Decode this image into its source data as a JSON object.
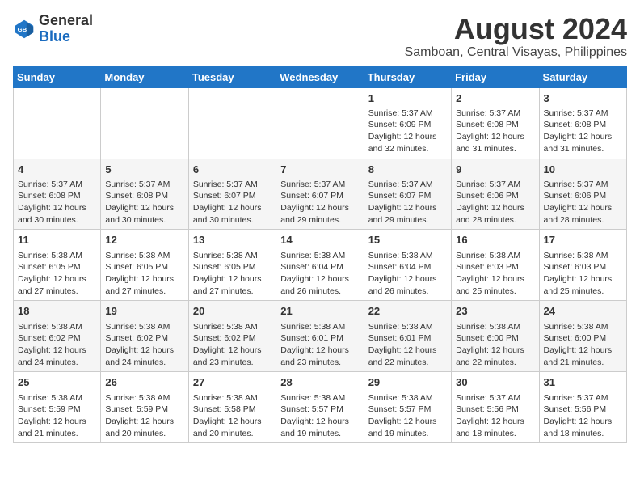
{
  "logo": {
    "general": "General",
    "blue": "Blue"
  },
  "title": "August 2024",
  "subtitle": "Samboan, Central Visayas, Philippines",
  "weekdays": [
    "Sunday",
    "Monday",
    "Tuesday",
    "Wednesday",
    "Thursday",
    "Friday",
    "Saturday"
  ],
  "weeks": [
    [
      {
        "day": "",
        "info": ""
      },
      {
        "day": "",
        "info": ""
      },
      {
        "day": "",
        "info": ""
      },
      {
        "day": "",
        "info": ""
      },
      {
        "day": "1",
        "info": "Sunrise: 5:37 AM\nSunset: 6:09 PM\nDaylight: 12 hours and 32 minutes."
      },
      {
        "day": "2",
        "info": "Sunrise: 5:37 AM\nSunset: 6:08 PM\nDaylight: 12 hours and 31 minutes."
      },
      {
        "day": "3",
        "info": "Sunrise: 5:37 AM\nSunset: 6:08 PM\nDaylight: 12 hours and 31 minutes."
      }
    ],
    [
      {
        "day": "4",
        "info": "Sunrise: 5:37 AM\nSunset: 6:08 PM\nDaylight: 12 hours and 30 minutes."
      },
      {
        "day": "5",
        "info": "Sunrise: 5:37 AM\nSunset: 6:08 PM\nDaylight: 12 hours and 30 minutes."
      },
      {
        "day": "6",
        "info": "Sunrise: 5:37 AM\nSunset: 6:07 PM\nDaylight: 12 hours and 30 minutes."
      },
      {
        "day": "7",
        "info": "Sunrise: 5:37 AM\nSunset: 6:07 PM\nDaylight: 12 hours and 29 minutes."
      },
      {
        "day": "8",
        "info": "Sunrise: 5:37 AM\nSunset: 6:07 PM\nDaylight: 12 hours and 29 minutes."
      },
      {
        "day": "9",
        "info": "Sunrise: 5:37 AM\nSunset: 6:06 PM\nDaylight: 12 hours and 28 minutes."
      },
      {
        "day": "10",
        "info": "Sunrise: 5:37 AM\nSunset: 6:06 PM\nDaylight: 12 hours and 28 minutes."
      }
    ],
    [
      {
        "day": "11",
        "info": "Sunrise: 5:38 AM\nSunset: 6:05 PM\nDaylight: 12 hours and 27 minutes."
      },
      {
        "day": "12",
        "info": "Sunrise: 5:38 AM\nSunset: 6:05 PM\nDaylight: 12 hours and 27 minutes."
      },
      {
        "day": "13",
        "info": "Sunrise: 5:38 AM\nSunset: 6:05 PM\nDaylight: 12 hours and 27 minutes."
      },
      {
        "day": "14",
        "info": "Sunrise: 5:38 AM\nSunset: 6:04 PM\nDaylight: 12 hours and 26 minutes."
      },
      {
        "day": "15",
        "info": "Sunrise: 5:38 AM\nSunset: 6:04 PM\nDaylight: 12 hours and 26 minutes."
      },
      {
        "day": "16",
        "info": "Sunrise: 5:38 AM\nSunset: 6:03 PM\nDaylight: 12 hours and 25 minutes."
      },
      {
        "day": "17",
        "info": "Sunrise: 5:38 AM\nSunset: 6:03 PM\nDaylight: 12 hours and 25 minutes."
      }
    ],
    [
      {
        "day": "18",
        "info": "Sunrise: 5:38 AM\nSunset: 6:02 PM\nDaylight: 12 hours and 24 minutes."
      },
      {
        "day": "19",
        "info": "Sunrise: 5:38 AM\nSunset: 6:02 PM\nDaylight: 12 hours and 24 minutes."
      },
      {
        "day": "20",
        "info": "Sunrise: 5:38 AM\nSunset: 6:02 PM\nDaylight: 12 hours and 23 minutes."
      },
      {
        "day": "21",
        "info": "Sunrise: 5:38 AM\nSunset: 6:01 PM\nDaylight: 12 hours and 23 minutes."
      },
      {
        "day": "22",
        "info": "Sunrise: 5:38 AM\nSunset: 6:01 PM\nDaylight: 12 hours and 22 minutes."
      },
      {
        "day": "23",
        "info": "Sunrise: 5:38 AM\nSunset: 6:00 PM\nDaylight: 12 hours and 22 minutes."
      },
      {
        "day": "24",
        "info": "Sunrise: 5:38 AM\nSunset: 6:00 PM\nDaylight: 12 hours and 21 minutes."
      }
    ],
    [
      {
        "day": "25",
        "info": "Sunrise: 5:38 AM\nSunset: 5:59 PM\nDaylight: 12 hours and 21 minutes."
      },
      {
        "day": "26",
        "info": "Sunrise: 5:38 AM\nSunset: 5:59 PM\nDaylight: 12 hours and 20 minutes."
      },
      {
        "day": "27",
        "info": "Sunrise: 5:38 AM\nSunset: 5:58 PM\nDaylight: 12 hours and 20 minutes."
      },
      {
        "day": "28",
        "info": "Sunrise: 5:38 AM\nSunset: 5:57 PM\nDaylight: 12 hours and 19 minutes."
      },
      {
        "day": "29",
        "info": "Sunrise: 5:38 AM\nSunset: 5:57 PM\nDaylight: 12 hours and 19 minutes."
      },
      {
        "day": "30",
        "info": "Sunrise: 5:37 AM\nSunset: 5:56 PM\nDaylight: 12 hours and 18 minutes."
      },
      {
        "day": "31",
        "info": "Sunrise: 5:37 AM\nSunset: 5:56 PM\nDaylight: 12 hours and 18 minutes."
      }
    ]
  ]
}
